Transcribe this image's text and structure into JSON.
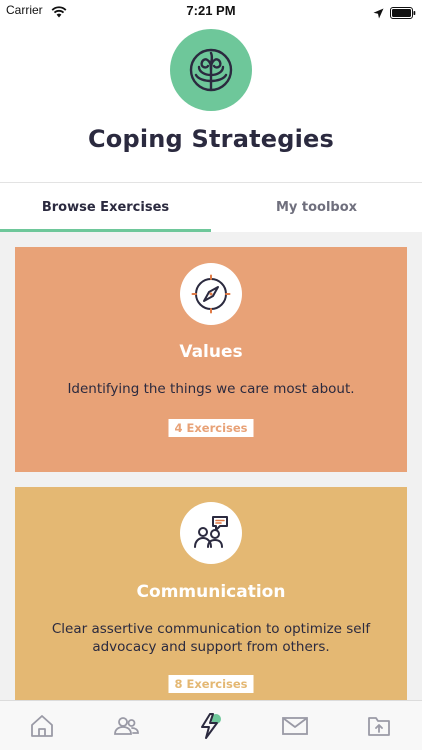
{
  "status_bar": {
    "carrier": "Carrier",
    "time": "7:21 PM"
  },
  "header": {
    "logo_icon": "tree-logo-icon",
    "title": "Coping Strategies"
  },
  "tabs": [
    {
      "label": "Browse Exercises",
      "active": true
    },
    {
      "label": "My toolbox",
      "active": false
    }
  ],
  "cards": [
    {
      "icon": "compass-icon",
      "title": "Values",
      "description": "Identifying the things we care most about.",
      "badge": "4 Exercises",
      "color": "#e8a277"
    },
    {
      "icon": "people-chat-icon",
      "title": "Communication",
      "description": "Clear assertive communication to optimize self advocacy and support from others.",
      "badge": "8 Exercises",
      "color": "#e4b873"
    }
  ],
  "tab_bar": {
    "items": [
      {
        "icon": "home-icon",
        "active": false
      },
      {
        "icon": "people-icon",
        "active": false
      },
      {
        "icon": "lightning-icon",
        "active": true
      },
      {
        "icon": "mail-icon",
        "active": false
      },
      {
        "icon": "folder-upload-icon",
        "active": false
      }
    ]
  },
  "colors": {
    "accent": "#6ec79a",
    "title_text": "#2b2a3f",
    "values_card": "#e8a277",
    "communication_card": "#e4b873"
  }
}
